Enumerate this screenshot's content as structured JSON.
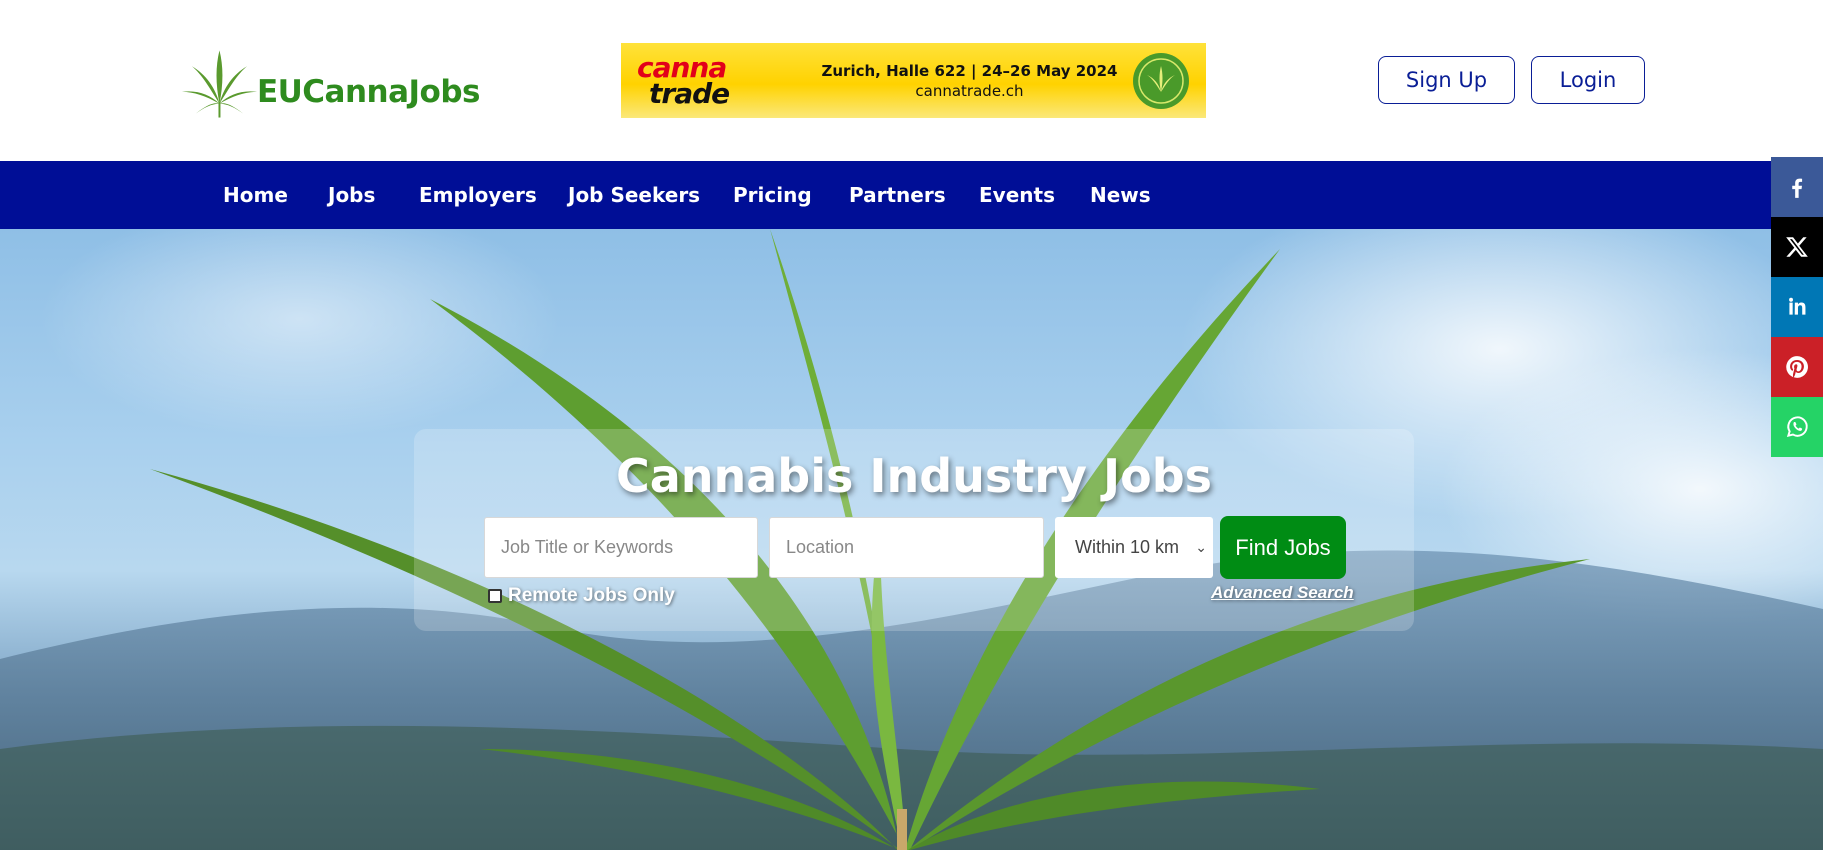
{
  "header": {
    "logo_text": "EUCannaJobs",
    "banner": {
      "brand_line1": "canna",
      "brand_line2": "trade",
      "info_line1": "Zurich, Halle 622 | 24–26 May 2024",
      "info_line2": "cannatrade.ch"
    },
    "signup_label": "Sign Up",
    "login_label": "Login"
  },
  "nav": {
    "items": [
      {
        "label": "Home"
      },
      {
        "label": "Jobs"
      },
      {
        "label": "Employers"
      },
      {
        "label": "Job Seekers"
      },
      {
        "label": "Pricing"
      },
      {
        "label": "Partners"
      },
      {
        "label": "Events"
      },
      {
        "label": "News"
      }
    ]
  },
  "hero": {
    "title": "Cannabis Industry Jobs",
    "keywords_placeholder": "Job Title or Keywords",
    "location_placeholder": "Location",
    "radius_selected": "Within 10 km",
    "find_label": "Find Jobs",
    "remote_label": "Remote Jobs Only",
    "advanced_label": "Advanced Search"
  },
  "share": [
    {
      "icon": "facebook-icon",
      "color": "#3b5998"
    },
    {
      "icon": "x-icon",
      "color": "#000000"
    },
    {
      "icon": "linkedin-icon",
      "color": "#0077b5"
    },
    {
      "icon": "pinterest-icon",
      "color": "#cb2027"
    },
    {
      "icon": "whatsapp-icon",
      "color": "#25d366"
    }
  ],
  "colors": {
    "nav_bg": "#000e96",
    "brand_green": "#2e8b1e",
    "find_button": "#008c14",
    "outline_button": "#0a1e96"
  }
}
